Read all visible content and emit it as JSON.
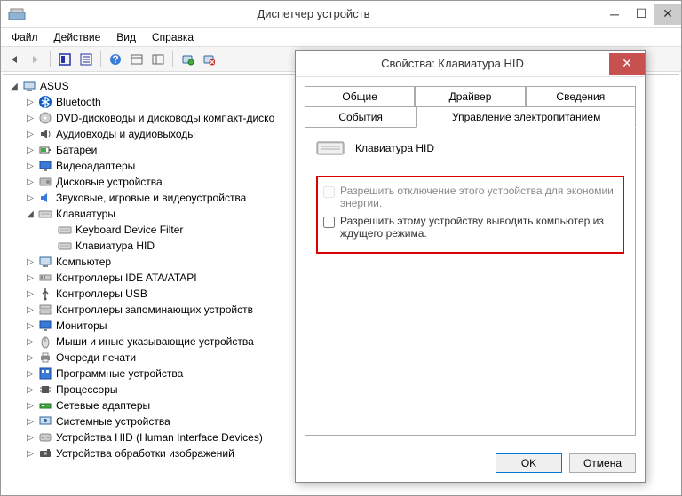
{
  "window": {
    "title": "Диспетчер устройств",
    "menus": [
      "Файл",
      "Действие",
      "Вид",
      "Справка"
    ]
  },
  "tree": {
    "root": "ASUS",
    "nodes": [
      {
        "label": "Bluetooth",
        "icon": "bluetooth"
      },
      {
        "label": "DVD-дисководы и дисководы компакт-диско",
        "icon": "dvd"
      },
      {
        "label": "Аудиовходы и аудиовыходы",
        "icon": "audio"
      },
      {
        "label": "Батареи",
        "icon": "battery"
      },
      {
        "label": "Видеоадаптеры",
        "icon": "display"
      },
      {
        "label": "Дисковые устройства",
        "icon": "disk"
      },
      {
        "label": "Звуковые, игровые и видеоустройства",
        "icon": "sound"
      },
      {
        "label": "Клавиатуры",
        "icon": "keyboard",
        "expanded": true,
        "children": [
          {
            "label": "Keyboard Device Filter",
            "icon": "keyboard"
          },
          {
            "label": "Клавиатура HID",
            "icon": "keyboard"
          }
        ]
      },
      {
        "label": "Компьютер",
        "icon": "computer"
      },
      {
        "label": "Контроллеры IDE ATA/ATAPI",
        "icon": "ide"
      },
      {
        "label": "Контроллеры USB",
        "icon": "usb"
      },
      {
        "label": "Контроллеры запоминающих устройств",
        "icon": "storage"
      },
      {
        "label": "Мониторы",
        "icon": "monitor"
      },
      {
        "label": "Мыши и иные указывающие устройства",
        "icon": "mouse"
      },
      {
        "label": "Очереди печати",
        "icon": "printer"
      },
      {
        "label": "Программные устройства",
        "icon": "software"
      },
      {
        "label": "Процессоры",
        "icon": "cpu"
      },
      {
        "label": "Сетевые адаптеры",
        "icon": "network"
      },
      {
        "label": "Системные устройства",
        "icon": "system"
      },
      {
        "label": "Устройства HID (Human Interface Devices)",
        "icon": "hid"
      },
      {
        "label": "Устройства обработки изображений",
        "icon": "imaging"
      }
    ]
  },
  "dialog": {
    "title": "Свойства: Клавиатура HID",
    "tabs_row1": [
      "Общие",
      "Драйвер",
      "Сведения"
    ],
    "tabs_row2": [
      "События",
      "Управление электропитанием"
    ],
    "active_tab": "Управление электропитанием",
    "device_name": "Клавиатура HID",
    "checkbox1": {
      "label": "Разрешить отключение этого устройства для экономии энергии.",
      "checked": false,
      "disabled": true
    },
    "checkbox2": {
      "label": "Разрешить этому устройству выводить компьютер из ждущего режима.",
      "checked": false,
      "disabled": false
    },
    "buttons": {
      "ok": "OK",
      "cancel": "Отмена"
    }
  }
}
